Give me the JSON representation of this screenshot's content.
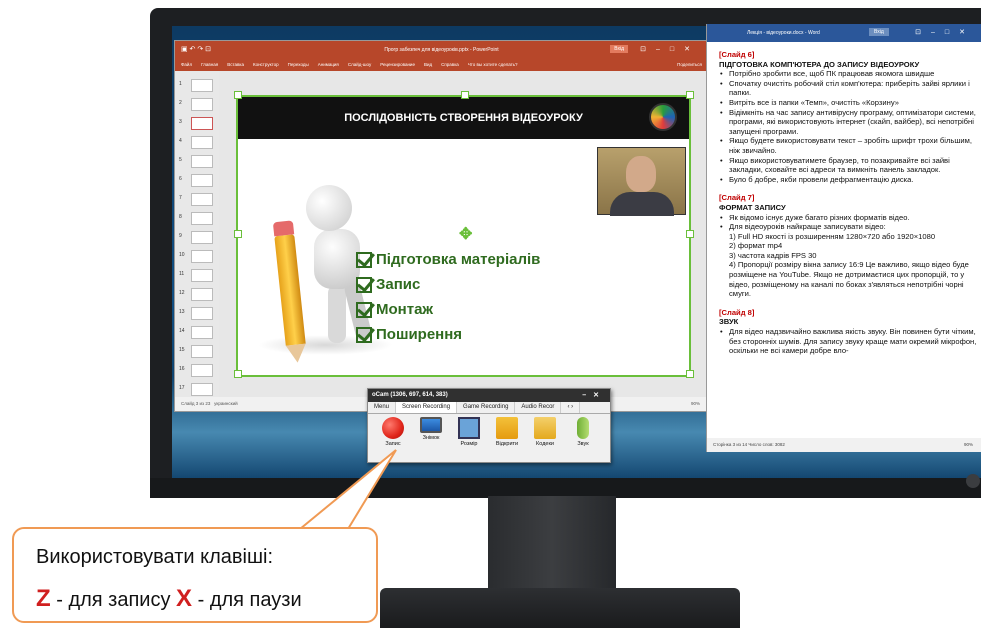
{
  "powerpoint": {
    "title": "Прогр забезпеч для відеоуроків.pptx - PowerPoint",
    "login": "Вхід",
    "ribbon_tabs": [
      "Файл",
      "Главная",
      "Вставка",
      "Конструктор",
      "Переходы",
      "Анимация",
      "Слайд-шоу",
      "Рецензирование",
      "Вид",
      "Справка",
      "Что вы хотите сделать?"
    ],
    "share": "Поделиться",
    "thumb_numbers": [
      "1",
      "2",
      "3",
      "4",
      "5",
      "6",
      "7",
      "8",
      "9",
      "10",
      "11",
      "12",
      "13",
      "14",
      "15",
      "16",
      "17"
    ],
    "status": "Слайд 3 из 23",
    "status_lang": "украинский",
    "zoom": "90%"
  },
  "slide": {
    "header": "ПОСЛІДОВНІСТЬ СТВОРЕННЯ ВІДЕОУРОКУ",
    "bullets": [
      "Підготовка матеріалів",
      "Запис",
      "Монтаж",
      "Поширення"
    ]
  },
  "word": {
    "title": "Лекція - відеоуроки.docx - Word",
    "login": "Вхід",
    "slide6_tag": "[Слайд 6]",
    "slide6_head": "ПІДГОТОВКА КОМП'ЮТЕРА ДО ЗАПИСУ ВІДЕОУРОКУ",
    "slide6_items": [
      "Потрібно зробити все, щоб ПК працював якомога швидше",
      "Спочатку очистіть робочий стіл комп'ютера: приберіть зайві ярлики і папки.",
      "Витріть все із папки «Темп», очистіть «Корзину»",
      "Відімкніть на час запису антивірусну програму, оптимізатори системи, програми, які використовують інтернет (скайп, вайбер), всі непотрібні запущені програми.",
      "Якщо будете використовувати текст – зробіть шрифт трохи більшим, ніж звичайно.",
      "Якщо використовуватимете браузер, то позакривайте всі зайві закладки, сховайте всі адреси та вимкніть панель закладок.",
      "Було б добре, якби провели дефрагментацію диска."
    ],
    "slide7_tag": "[Слайд 7]",
    "slide7_head": "ФОРМАТ ЗАПИСУ",
    "slide7_items": [
      "Як відомо існує дуже багато різних форматів відео.",
      "Для відеоуроків найкраще записувати відео:"
    ],
    "slide7_sub": [
      "1) Full HD якості із розширенням 1280×720 або 1920×1080",
      "2) формат mp4",
      "3) частота кадрів FPS 30",
      "4) Пропорції розміру вікна запису 16:9 Це важливо, якщо відео буде розміщене на YouTube. Якщо не дотримаєтися цих пропорцій, то у відео, розміщеному на каналі по боках з'являться непотрібні чорні смуги."
    ],
    "slide8_tag": "[Слайд 8]",
    "slide8_head": "ЗВУК",
    "slide8_text": "Для відео надзвичайно важлива якість звуку. Він повинен бути чітким, без сторонніх шумів. Для запису звуку краще мати окремий мікрофон, оскільки не всі камери добре вло-",
    "status": "Сторінка 3 из 14   Число слов: 3082",
    "zoom": "90%"
  },
  "ocam": {
    "title": "oCam (1306, 697, 614, 383)",
    "tabs": [
      "Menu",
      "Screen Recording",
      "Game Recording",
      "Audio Recor"
    ],
    "tools": [
      {
        "label": "Запис",
        "icon": "record-icon"
      },
      {
        "label": "Знімок",
        "icon": "screenshot-icon"
      },
      {
        "label": "Розмір",
        "icon": "resize-icon"
      },
      {
        "label": "Відкрити",
        "icon": "folder-icon"
      },
      {
        "label": "Кодеки",
        "icon": "codec-icon"
      },
      {
        "label": "Звук",
        "icon": "microphone-icon"
      }
    ]
  },
  "callout": {
    "line1": "Використовувати клавіші:",
    "key1": "Z",
    "text1": " - для запису ",
    "key2": "X",
    "text2": " - для паузи"
  },
  "colors": {
    "ppt_accent": "#b7472a",
    "word_accent": "#2b579a",
    "slide_green": "#2f6b1f",
    "callout_border": "#f09a54",
    "key_red": "#d01f1f"
  }
}
